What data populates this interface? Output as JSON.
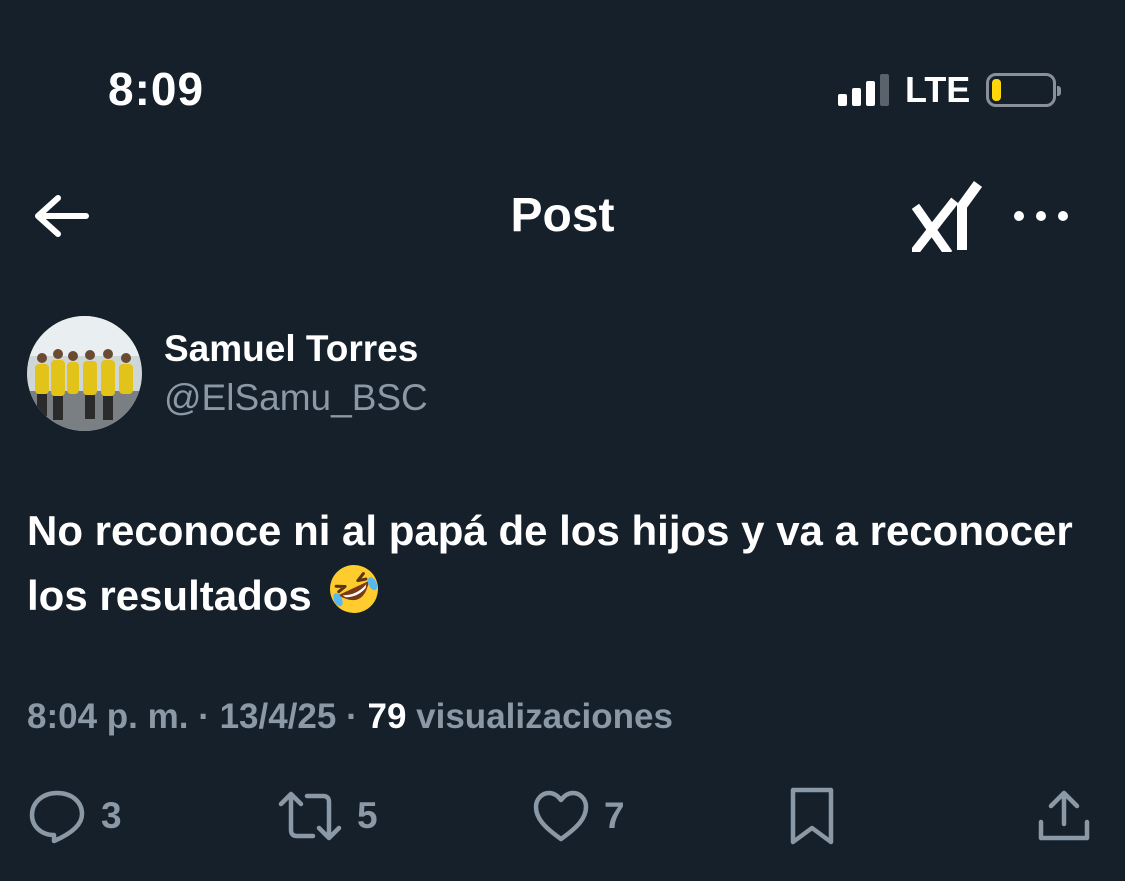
{
  "status_bar": {
    "time": "8:09",
    "network": "LTE",
    "battery_color": "#ffd60a"
  },
  "header": {
    "title": "Post",
    "back_icon": "arrow-left-icon",
    "grok_icon": "grok-icon",
    "more_icon": "more-horizontal-icon"
  },
  "author": {
    "name": "Samuel Torres",
    "handle": "@ElSamu_BSC"
  },
  "post": {
    "text": "No reconoce ni al papá de los hijos y va a reconocer los resultados",
    "emoji": "rolling-on-floor-laughing-emoji"
  },
  "meta": {
    "time": "8:04 p. m.",
    "separator": "·",
    "date": "13/4/25",
    "views_count": "79",
    "views_label": "visualizaciones"
  },
  "actions": {
    "replies": "3",
    "reposts": "5",
    "likes": "7"
  },
  "colors": {
    "background": "#15202b",
    "secondary_text": "#8b98a5",
    "primary_text": "#ffffff"
  }
}
